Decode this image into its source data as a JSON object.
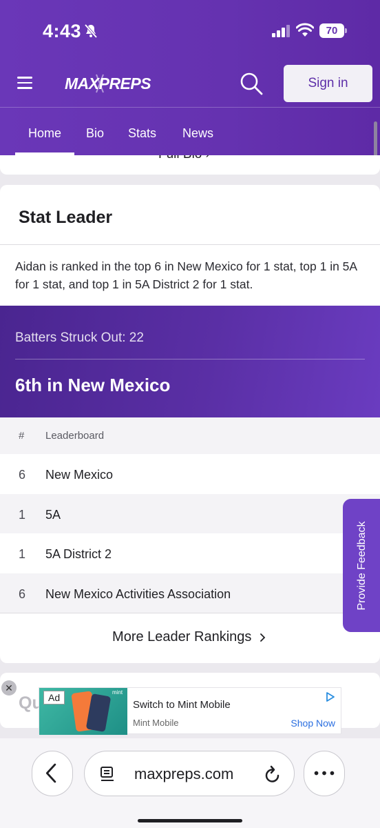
{
  "status_bar": {
    "time": "4:43",
    "battery": "70"
  },
  "header": {
    "brand": "MAXPREPS",
    "sign_in": "Sign in"
  },
  "tabs": [
    {
      "label": "Home",
      "active": true
    },
    {
      "label": "Bio"
    },
    {
      "label": "Stats"
    },
    {
      "label": "News"
    }
  ],
  "prev_card": {
    "link": "Full Bio ›"
  },
  "stat_leader": {
    "title": "Stat Leader",
    "summary": "Aidan is ranked in the top 6 in New Mexico for 1 stat, top 1 in 5A for 1 stat, and top 1 in 5A District 2 for 1 stat.",
    "stat_line": "Batters Struck Out: 22",
    "rank_line": "6th in New Mexico",
    "table": {
      "headers": [
        "#",
        "Leaderboard"
      ],
      "rows": [
        {
          "rank": "6",
          "board": "New Mexico"
        },
        {
          "rank": "1",
          "board": "5A"
        },
        {
          "rank": "1",
          "board": "5A District 2"
        },
        {
          "rank": "6",
          "board": "New Mexico Activities Association"
        }
      ]
    },
    "more_link": "More Leader Rankings"
  },
  "feedback_tab": "Provide Feedback",
  "next_card": {
    "title_partial": "Qu"
  },
  "ad": {
    "tag": "Ad",
    "brand_small": "mint",
    "title": "Switch to Mint Mobile",
    "advertiser": "Mint Mobile",
    "cta": "Shop Now"
  },
  "browser": {
    "url": "maxpreps.com"
  },
  "colors": {
    "brand_purple": "#6532b0",
    "feedback_purple": "#6f42c6",
    "link_blue": "#2a6ee0"
  }
}
